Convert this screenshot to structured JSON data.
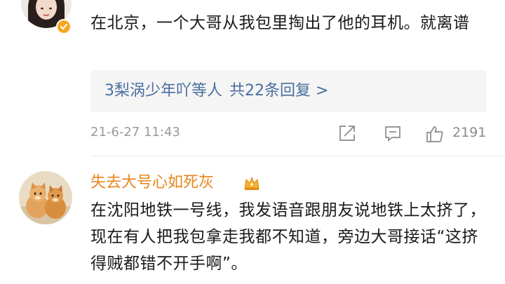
{
  "comment1": {
    "text": "在北京，一个大哥从我包里掏出了他的耳机。就离谱",
    "replies": {
      "names": "3梨涡少年吖等人",
      "count": "共22条回复",
      "chevron": ">"
    },
    "time": "21-6-27 11:43",
    "likes": "2191"
  },
  "comment2": {
    "username": "失去大号心如死灰",
    "text": "在沈阳地铁一号线，我发语音跟朋友说地铁上太挤了，现在有人把我包拿走我都不知道，旁边大哥接话“这挤得贼都错不开手啊”。"
  },
  "colors": {
    "link": "#4a6fa0",
    "username": "#e8861c",
    "meta": "#9a9a9a",
    "badge": "#f6a623"
  },
  "icons": [
    "verified-badge-icon",
    "share-icon",
    "comment-icon",
    "like-icon",
    "crown-icon"
  ]
}
